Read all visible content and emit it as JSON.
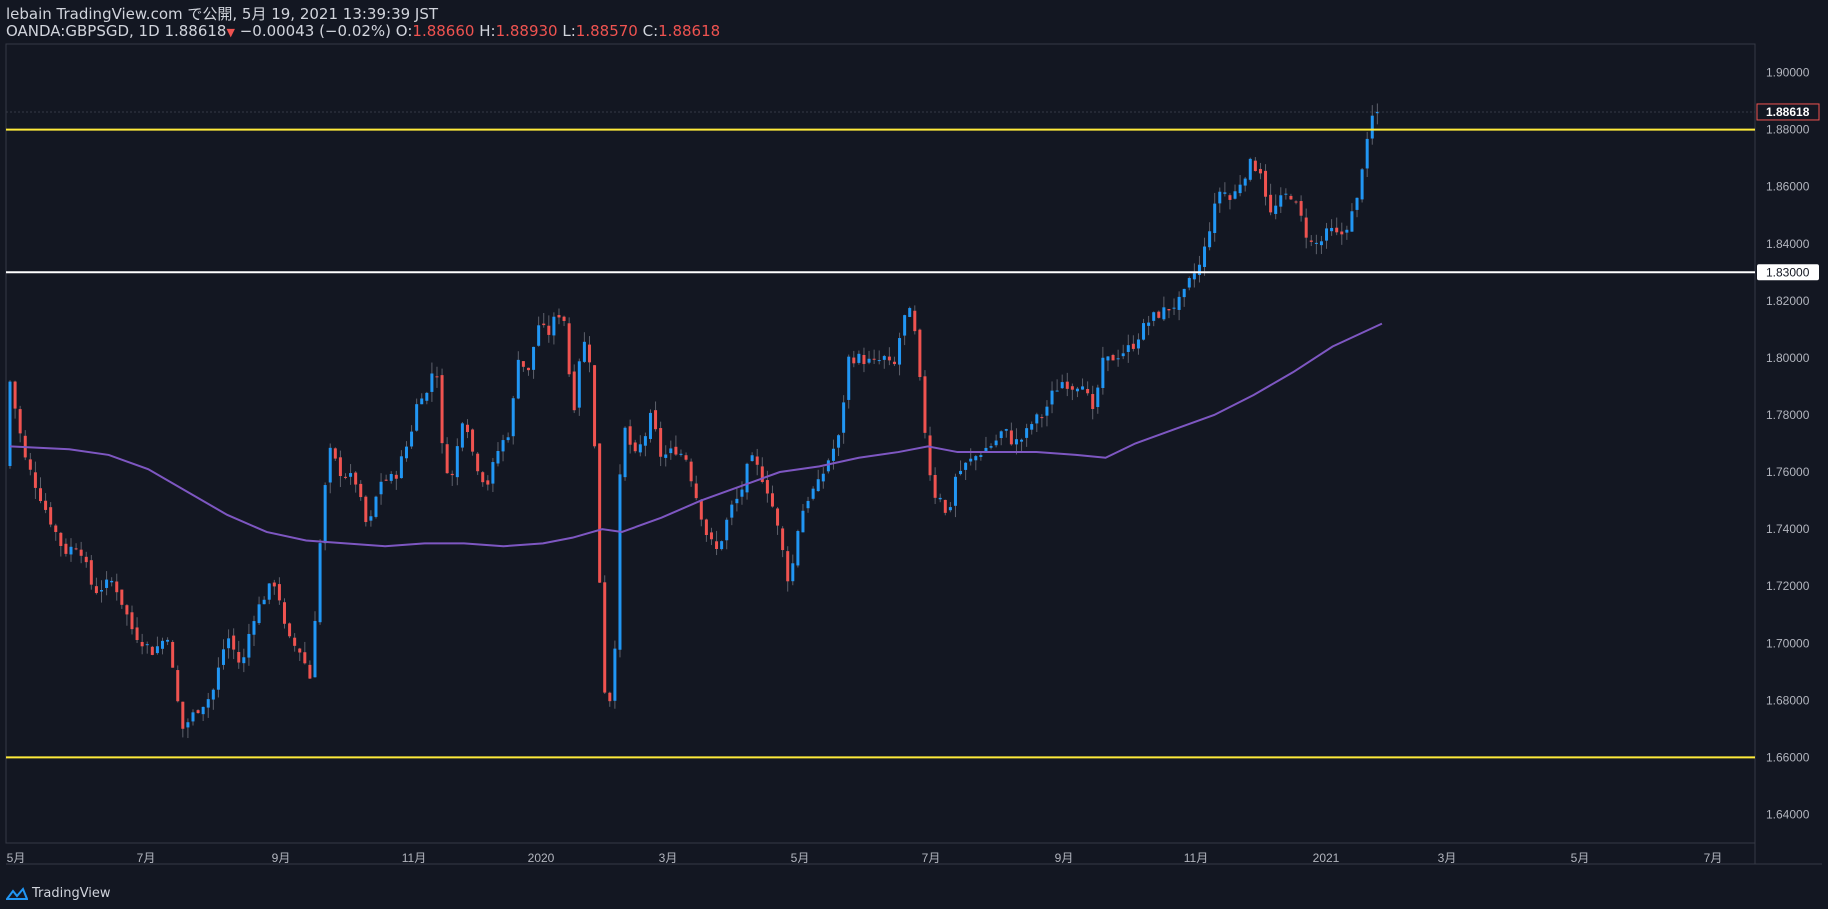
{
  "header": {
    "line1": "lebain TradingView.com で公開, 5月 19, 2021 13:39:39 JST",
    "symbol": "OANDA:GBPSGD, 1D",
    "last": "1.88618",
    "change": "−0.00043 (−0.02%)",
    "o_label": "O:",
    "o_value": "1.88660",
    "h_label": "H:",
    "h_value": "1.88930",
    "l_label": "L:",
    "l_value": "1.88570",
    "c_label": "C:",
    "c_value": "1.88618"
  },
  "footer": {
    "brand": "TradingView"
  },
  "colors": {
    "background": "#131722",
    "up": "#2196f3",
    "down": "#ef5350",
    "ma": "#7e57c2",
    "level_yellow": "#ffeb3b",
    "level_white": "#ffffff",
    "axis_text": "#b2b5be"
  },
  "chart_data": {
    "type": "candlestick",
    "symbol": "OANDA:GBPSGD",
    "interval": "1D",
    "ylim": [
      1.63,
      1.91
    ],
    "y_ticks": [
      "1.64000",
      "1.66000",
      "1.68000",
      "1.70000",
      "1.72000",
      "1.74000",
      "1.76000",
      "1.78000",
      "1.80000",
      "1.82000",
      "1.84000",
      "1.86000",
      "1.88000",
      "1.90000"
    ],
    "x_tick_labels": [
      "5月",
      "7月",
      "9月",
      "11月",
      "2020",
      "3月",
      "5月",
      "7月",
      "9月",
      "11月",
      "2021",
      "3月",
      "5月",
      "7月"
    ],
    "last_price_label": "1.88618",
    "horizontal_levels": [
      {
        "value": 1.88,
        "color": "yellow"
      },
      {
        "value": 1.83,
        "color": "white",
        "label": "1.83000"
      },
      {
        "value": 1.66,
        "color": "yellow"
      }
    ],
    "price_path": [
      [
        0,
        1.762
      ],
      [
        5,
        1.792
      ],
      [
        20,
        1.765
      ],
      [
        40,
        1.748
      ],
      [
        60,
        1.732
      ],
      [
        75,
        1.735
      ],
      [
        90,
        1.718
      ],
      [
        110,
        1.722
      ],
      [
        130,
        1.704
      ],
      [
        150,
        1.697
      ],
      [
        165,
        1.703
      ],
      [
        172,
        1.685
      ],
      [
        180,
        1.67
      ],
      [
        195,
        1.677
      ],
      [
        210,
        1.682
      ],
      [
        225,
        1.703
      ],
      [
        240,
        1.691
      ],
      [
        250,
        1.708
      ],
      [
        265,
        1.718
      ],
      [
        275,
        1.722
      ],
      [
        285,
        1.702
      ],
      [
        300,
        1.697
      ],
      [
        310,
        1.687
      ],
      [
        318,
        1.73
      ],
      [
        328,
        1.768
      ],
      [
        340,
        1.76
      ],
      [
        355,
        1.757
      ],
      [
        368,
        1.739
      ],
      [
        380,
        1.757
      ],
      [
        395,
        1.758
      ],
      [
        410,
        1.772
      ],
      [
        420,
        1.788
      ],
      [
        430,
        1.787
      ],
      [
        436,
        1.805
      ],
      [
        442,
        1.77
      ],
      [
        452,
        1.756
      ],
      [
        465,
        1.782
      ],
      [
        475,
        1.765
      ],
      [
        488,
        1.755
      ],
      [
        500,
        1.768
      ],
      [
        512,
        1.775
      ],
      [
        520,
        1.801
      ],
      [
        530,
        1.794
      ],
      [
        540,
        1.812
      ],
      [
        550,
        1.808
      ],
      [
        560,
        1.816
      ],
      [
        568,
        1.813
      ],
      [
        575,
        1.778
      ],
      [
        582,
        1.8
      ],
      [
        590,
        1.808
      ],
      [
        595,
        1.79
      ],
      [
        600,
        1.745
      ],
      [
        605,
        1.7
      ],
      [
        610,
        1.67
      ],
      [
        618,
        1.7
      ],
      [
        625,
        1.778
      ],
      [
        638,
        1.765
      ],
      [
        648,
        1.772
      ],
      [
        655,
        1.78
      ],
      [
        665,
        1.765
      ],
      [
        680,
        1.768
      ],
      [
        690,
        1.765
      ],
      [
        700,
        1.752
      ],
      [
        712,
        1.737
      ],
      [
        722,
        1.732
      ],
      [
        735,
        1.747
      ],
      [
        745,
        1.752
      ],
      [
        755,
        1.765
      ],
      [
        765,
        1.76
      ],
      [
        775,
        1.752
      ],
      [
        785,
        1.737
      ],
      [
        795,
        1.72
      ],
      [
        805,
        1.744
      ],
      [
        815,
        1.752
      ],
      [
        825,
        1.756
      ],
      [
        835,
        1.765
      ],
      [
        845,
        1.772
      ],
      [
        855,
        1.8
      ],
      [
        865,
        1.8
      ],
      [
        880,
        1.798
      ],
      [
        892,
        1.8
      ],
      [
        900,
        1.795
      ],
      [
        908,
        1.81
      ],
      [
        915,
        1.818
      ],
      [
        922,
        1.808
      ],
      [
        932,
        1.775
      ],
      [
        940,
        1.752
      ],
      [
        948,
        1.752
      ],
      [
        955,
        1.742
      ],
      [
        962,
        1.758
      ],
      [
        972,
        1.762
      ],
      [
        982,
        1.765
      ],
      [
        992,
        1.768
      ],
      [
        1002,
        1.77
      ],
      [
        1012,
        1.775
      ],
      [
        1022,
        1.77
      ],
      [
        1032,
        1.772
      ],
      [
        1042,
        1.778
      ],
      [
        1052,
        1.78
      ],
      [
        1062,
        1.788
      ],
      [
        1072,
        1.792
      ],
      [
        1082,
        1.79
      ],
      [
        1092,
        1.792
      ],
      [
        1102,
        1.78
      ],
      [
        1112,
        1.798
      ],
      [
        1122,
        1.8
      ],
      [
        1132,
        1.802
      ],
      [
        1142,
        1.804
      ],
      [
        1152,
        1.81
      ],
      [
        1162,
        1.814
      ],
      [
        1172,
        1.816
      ],
      [
        1182,
        1.818
      ],
      [
        1192,
        1.82
      ],
      [
        1202,
        1.828
      ],
      [
        1212,
        1.833
      ],
      [
        1222,
        1.848
      ],
      [
        1232,
        1.86
      ],
      [
        1242,
        1.855
      ],
      [
        1252,
        1.862
      ],
      [
        1262,
        1.868
      ],
      [
        1272,
        1.866
      ],
      [
        1282,
        1.85
      ],
      [
        1292,
        1.855
      ],
      [
        1302,
        1.858
      ],
      [
        1312,
        1.85
      ],
      [
        1322,
        1.84
      ],
      [
        1332,
        1.84
      ],
      [
        1342,
        1.845
      ],
      [
        1352,
        1.842
      ],
      [
        1362,
        1.848
      ],
      [
        1370,
        1.855
      ],
      [
        1376,
        1.87
      ],
      [
        1383,
        1.878
      ],
      [
        1386,
        1.886
      ]
    ],
    "ma_path": [
      [
        0,
        1.769
      ],
      [
        60,
        1.768
      ],
      [
        100,
        1.766
      ],
      [
        140,
        1.761
      ],
      [
        180,
        1.753
      ],
      [
        220,
        1.745
      ],
      [
        260,
        1.739
      ],
      [
        300,
        1.736
      ],
      [
        340,
        1.735
      ],
      [
        380,
        1.734
      ],
      [
        420,
        1.735
      ],
      [
        460,
        1.735
      ],
      [
        500,
        1.734
      ],
      [
        540,
        1.735
      ],
      [
        570,
        1.737
      ],
      [
        600,
        1.74
      ],
      [
        620,
        1.739
      ],
      [
        660,
        1.744
      ],
      [
        700,
        1.75
      ],
      [
        740,
        1.755
      ],
      [
        780,
        1.76
      ],
      [
        820,
        1.762
      ],
      [
        860,
        1.765
      ],
      [
        900,
        1.767
      ],
      [
        930,
        1.769
      ],
      [
        960,
        1.767
      ],
      [
        1000,
        1.767
      ],
      [
        1040,
        1.767
      ],
      [
        1080,
        1.766
      ],
      [
        1110,
        1.765
      ],
      [
        1140,
        1.77
      ],
      [
        1180,
        1.775
      ],
      [
        1220,
        1.78
      ],
      [
        1260,
        1.787
      ],
      [
        1300,
        1.795
      ],
      [
        1340,
        1.804
      ],
      [
        1390,
        1.812
      ]
    ]
  }
}
